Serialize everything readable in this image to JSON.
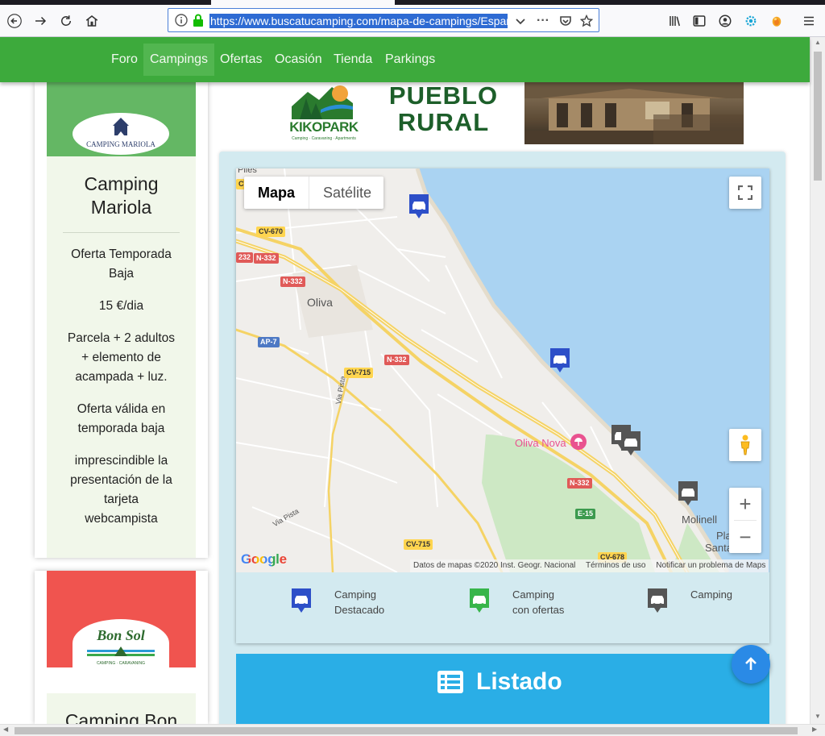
{
  "browser": {
    "url": "https://www.buscatucamping.com/mapa-de-campings/Espan",
    "toolbar_icons": [
      "back-arrow-icon",
      "forward-arrow-icon",
      "reload-icon",
      "home-icon",
      "info-icon",
      "lock-icon",
      "dropdown-chevron-icon",
      "more-dots-icon",
      "pocket-icon",
      "star-icon",
      "library-icon",
      "sidebar-icon",
      "account-icon",
      "extension-gear-icon",
      "extension-orange-icon",
      "menu-icon"
    ]
  },
  "nav": {
    "items": [
      {
        "label": "Foro",
        "active": false
      },
      {
        "label": "Campings",
        "active": true
      },
      {
        "label": "Ofertas",
        "active": false
      },
      {
        "label": "Ocasión",
        "active": false
      },
      {
        "label": "Tienda",
        "active": false
      },
      {
        "label": "Parkings",
        "active": false
      }
    ],
    "color": "#3daa3c"
  },
  "cards": [
    {
      "logo_text": "CAMPING MARIOLA",
      "title_line1": "Camping",
      "title_line2": "Mariola",
      "offer_title_line1": "Oferta Temporada",
      "offer_title_line2": "Baja",
      "price": "15 €/dia",
      "desc_line1": "Parcela + 2 adultos",
      "desc_line2": "+ elemento de",
      "desc_line3": "acampada + luz.",
      "valid_line1": "Oferta válida en",
      "valid_line2": "temporada baja",
      "note_line1": "imprescindible la",
      "note_line2": "presentación de la",
      "note_line3": "tarjeta",
      "note_line4": "webcampista",
      "header_color": "#64b764"
    },
    {
      "logo_text": "Bon Sol",
      "logo_sub": "CAMPING · CARAVANING",
      "title_partial": "Camping Bon",
      "header_color": "#f0544f"
    }
  ],
  "banner": {
    "brand": "KIKOPARK",
    "brand_sub": "Camping · Caravaning · Apartments",
    "headline_line1": "PUEBLO",
    "headline_line2": "RURAL"
  },
  "map": {
    "type_buttons": {
      "map": "Mapa",
      "satellite": "Satélite"
    },
    "place_labels": {
      "oliva": "Oliva",
      "oliva_nova": "Oliva Nova",
      "molinell": "Molinell",
      "pla": "Pla",
      "santa": "Santa",
      "top_cut": "Piles",
      "via_pista_1": "Via Pista",
      "via_pista_2": "Via Pista"
    },
    "roads": {
      "cv670": "CV-670",
      "n332a": "N-332",
      "n332b": "N-332",
      "n332c": "N-332",
      "n332d": "N-332",
      "r232": "232",
      "ap7": "AP-7",
      "cv715a": "CV-715",
      "cv715b": "CV-715",
      "e15": "E-15",
      "cv678": "CV-678",
      "cvleft": "CV"
    },
    "google": "Google",
    "attribution": {
      "data": "Datos de mapas ©2020 Inst. Geogr. Nacional",
      "terms": "Términos de uso",
      "report": "Notificar un problema de Maps"
    },
    "zoom_in": "+",
    "zoom_out": "−",
    "colors": {
      "water": "#a7d7f1",
      "land": "#f0eeeb",
      "green": "#cbe6c3",
      "highway": "#f7d56a"
    }
  },
  "legend": [
    {
      "line1": "Camping",
      "line2": "Destacado",
      "color": "#2d4fc8"
    },
    {
      "line1": "Camping",
      "line2": "con ofertas",
      "color": "#37b54a"
    },
    {
      "line1": "Camping",
      "line2": "",
      "color": "#555555"
    }
  ],
  "listado": {
    "title": "Listado",
    "color": "#2aaee6"
  }
}
